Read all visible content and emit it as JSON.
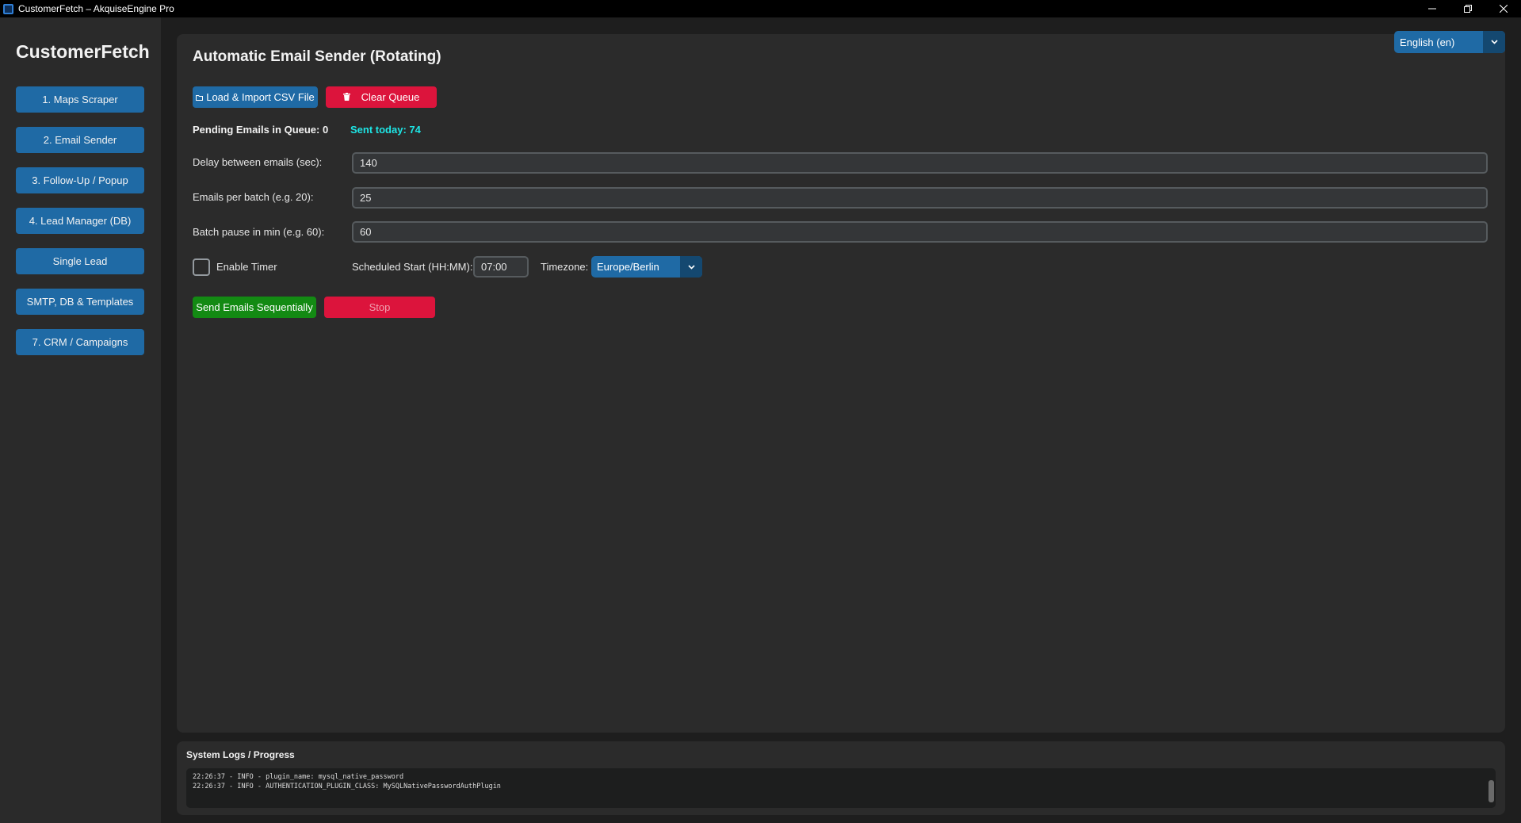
{
  "window": {
    "title": "CustomerFetch – AkquiseEngine Pro"
  },
  "sidebar": {
    "brand": "CustomerFetch",
    "items": [
      {
        "label": "1. Maps Scraper"
      },
      {
        "label": "2. Email Sender"
      },
      {
        "label": "3. Follow-Up / Popup"
      },
      {
        "label": "4. Lead Manager (DB)"
      },
      {
        "label": "Single Lead"
      },
      {
        "label": "SMTP, DB & Templates"
      },
      {
        "label": "7. CRM / Campaigns"
      }
    ]
  },
  "language": {
    "selected": "English (en)"
  },
  "main": {
    "heading": "Automatic Email Sender (Rotating)",
    "load_button": "Load & Import CSV File",
    "clear_button": "Clear Queue",
    "pending_label": "Pending Emails in Queue: 0",
    "sent_today_label": "Sent today: 74",
    "delay_label": "Delay between emails (sec):",
    "delay_value": "140",
    "batch_label": "Emails per batch (e.g. 20):",
    "batch_value": "25",
    "pause_label": "Batch pause in min (e.g. 60):",
    "pause_value": "60",
    "timer_label": "Enable Timer",
    "timer_enabled": false,
    "schedule_label": "Scheduled Start (HH:MM):",
    "schedule_value": "07:00",
    "timezone_label": "Timezone:",
    "timezone_value": "Europe/Berlin",
    "send_button": "Send Emails Sequentially",
    "stop_button": "Stop"
  },
  "logs": {
    "title": "System Logs / Progress",
    "lines": [
      "22:26:37 - INFO - plugin_name: mysql_native_password",
      "22:26:37 - INFO - AUTHENTICATION_PLUGIN_CLASS: MySQLNativePasswordAuthPlugin"
    ]
  },
  "colors": {
    "accent": "#1f6aa5",
    "danger": "#dc143c",
    "success": "#138a13",
    "sent_today": "#1ee6e6"
  }
}
